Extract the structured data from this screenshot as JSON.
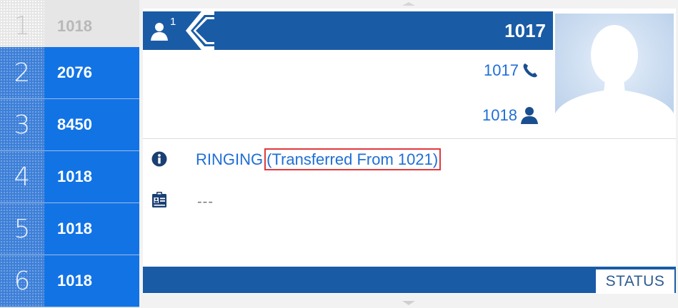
{
  "lines": [
    {
      "index": "1",
      "label": "1018",
      "state": "idle"
    },
    {
      "index": "2",
      "label": "2076",
      "state": "active"
    },
    {
      "index": "3",
      "label": "8450",
      "state": "active"
    },
    {
      "index": "4",
      "label": "1018",
      "state": "active"
    },
    {
      "index": "5",
      "label": "1018",
      "state": "active"
    },
    {
      "index": "6",
      "label": "1018",
      "state": "active"
    }
  ],
  "call": {
    "contacts_icon": "contacts-icon",
    "contacts_count": "1",
    "title": "1017",
    "number": "1017",
    "number_icon": "phone-icon",
    "caller": "1018",
    "caller_icon": "person-icon",
    "avatar_icon": "avatar-silhouette"
  },
  "status": {
    "icon": "info-icon",
    "state": "RINGING",
    "detail": "(Transferred From 1021)"
  },
  "note": {
    "icon": "clipboard-icon",
    "text": "---"
  },
  "softkeys": {
    "status_label": "STATUS"
  },
  "colors": {
    "header_blue": "#1a5ba6",
    "line_blue": "#1273e5",
    "text_blue": "#1f6fd6",
    "highlight_red": "#e0393e"
  }
}
